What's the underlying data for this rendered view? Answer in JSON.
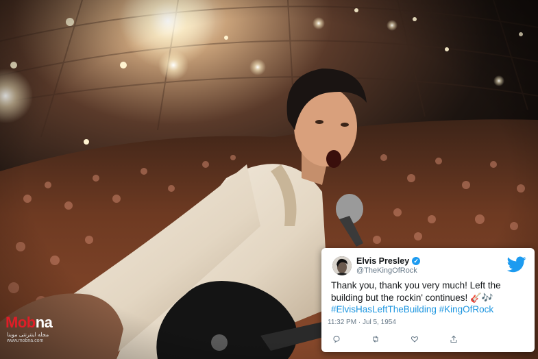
{
  "photo": {
    "subject": "performer-selfie-with-crowd",
    "colors": {
      "stage_light": "#fff6d6",
      "crowd": "#7a3d22",
      "jacket": "#efe6d8",
      "guitar": "#141414"
    }
  },
  "tweet": {
    "name": "Elvis Presley",
    "handle": "@TheKingOfRock",
    "text": "Thank you, thank you very much! Left the building but the rockin' continues! 🎸🎶",
    "hashtags": "#ElvisHasLeftTheBuilding #KingOfRock",
    "time": "11:32 PM",
    "separator": "·",
    "date": "Jul 5, 1954",
    "icons": [
      "reply-icon",
      "retweet-icon",
      "like-icon",
      "share-icon"
    ],
    "colors": {
      "brand": "#1d9bf0",
      "hashtag": "#1b95e0",
      "muted": "#657786"
    }
  },
  "watermark": {
    "logo_a": "Mob",
    "logo_b": "na",
    "subtitle": "مجله اینترنتی موبنا",
    "url": "www.mobna.com"
  }
}
